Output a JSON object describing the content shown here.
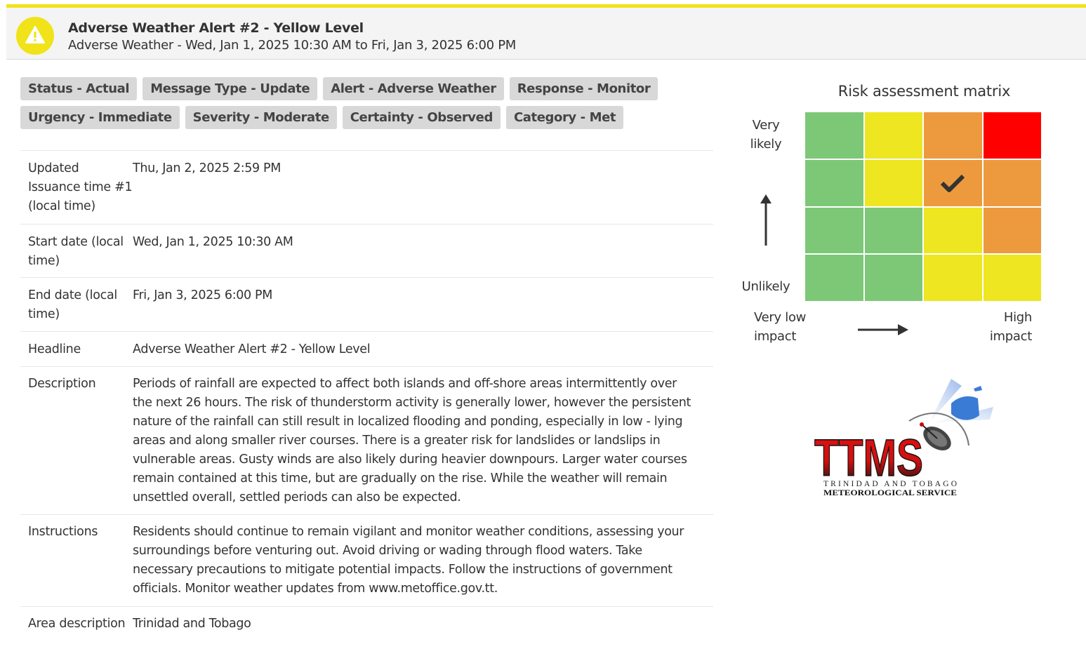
{
  "header": {
    "title": "Adverse Weather Alert #2 - Yellow Level",
    "subtitle": "Adverse Weather - Wed, Jan 1, 2025 10:30 AM to Fri, Jan 3, 2025 6:00 PM",
    "icon": "warning-triangle-icon",
    "accent_color": "#f0e31a"
  },
  "chips": [
    [
      "Status - Actual",
      "Message Type - Update",
      "Alert - Adverse Weather",
      "Response - Monitor"
    ],
    [
      "Urgency - Immediate",
      "Severity - Moderate",
      "Certainty - Observed",
      "Category - Met"
    ]
  ],
  "details": {
    "issuance": {
      "label": "Updated Issuance time #1 (local time)",
      "value": "Thu, Jan 2, 2025 2:59 PM"
    },
    "start": {
      "label": "Start date (local time)",
      "value": "Wed, Jan 1, 2025 10:30 AM"
    },
    "end": {
      "label": "End date (local time)",
      "value": "Fri, Jan 3, 2025 6:00 PM"
    },
    "headline": {
      "label": "Headline",
      "value": "Adverse Weather Alert #2 - Yellow Level"
    },
    "description": {
      "label": "Description",
      "value": "Periods of rainfall are expected to affect both islands and off-shore areas intermittently over the next 26 hours. The risk of thunderstorm activity is generally lower, however the persistent nature of the rainfall can still result in localized flooding and ponding, especially in low - lying areas and along smaller river courses. There is a greater risk for landslides or landslips in vulnerable areas. Gusty winds are also likely during heavier downpours. Larger water courses remain contained at this time, but are gradually on the rise. While the weather will remain unsettled overall, settled periods can also be expected."
    },
    "instructions": {
      "label": "Instructions",
      "value": "Residents should continue to remain vigilant and monitor weather conditions, assessing your surroundings before venturing out. Avoid driving or wading through flood waters. Take necessary precautions to mitigate potential impacts. Follow the instructions of government officials. Monitor weather updates from www.metoffice.gov.tt."
    },
    "area": {
      "label": "Area description",
      "value": "Trinidad and Tobago"
    }
  },
  "risk_matrix": {
    "title": "Risk assessment matrix",
    "y_top_label": "Very likely",
    "y_bottom_label": "Unlikely",
    "x_left_label": "Very low impact",
    "x_right_label": "High impact",
    "selected_cell": {
      "likelihood_row": 1,
      "impact_column": 2
    },
    "colors": {
      "green": "#7cc876",
      "yellow": "#ede620",
      "orange": "#ed9a3e",
      "red": "#fe0000"
    },
    "rows": [
      [
        "green",
        "yellow",
        "orange",
        "red"
      ],
      [
        "green",
        "yellow",
        "orange",
        "orange"
      ],
      [
        "green",
        "green",
        "yellow",
        "orange"
      ],
      [
        "green",
        "green",
        "yellow",
        "yellow"
      ]
    ]
  },
  "logo": {
    "wordmark": "TTMS",
    "line1": "TRINIDAD AND TOBAGO",
    "line2": "METEOROLOGICAL SERVICE"
  }
}
